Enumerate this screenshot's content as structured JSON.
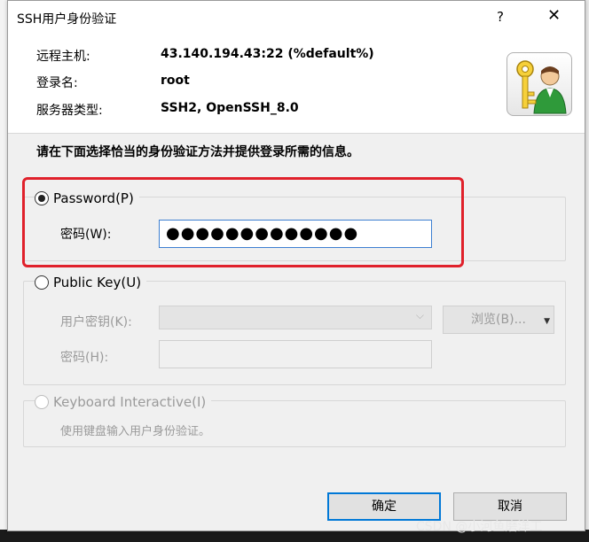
{
  "dialog": {
    "title": "SSH用户身份验证",
    "help": "?",
    "close": "✕"
  },
  "info": {
    "host_label": "远程主机:",
    "host_value": "43.140.194.43:22 (%default%)",
    "login_label": "登录名:",
    "login_value": "root",
    "server_type_label": "服务器类型:",
    "server_type_value": "SSH2, OpenSSH_8.0",
    "icon": "key-user-icon"
  },
  "instruction": "请在下面选择恰当的身份验证方法并提供登录所需的信息。",
  "password_section": {
    "radio_label": "Password",
    "radio_mnemonic": "(P)",
    "checked": true,
    "field_label": "密码(W):",
    "field_value": "●●●●●●●●●●●●●"
  },
  "public_key_section": {
    "radio_label": "Public Key",
    "radio_mnemonic": "(U)",
    "user_key_label": "用户密钥(K):",
    "browse_label": "浏览(B)...",
    "passphrase_label": "密码(H):"
  },
  "keyboard_section": {
    "radio_label": "Keyboard Interactive",
    "radio_mnemonic": "(I)",
    "hint": "使用键盘输入用户身份验证。"
  },
  "buttons": {
    "ok": "确定",
    "cancel": "取消"
  },
  "watermark": "CSDN @小河鱼磨洋工",
  "colors": {
    "highlight": "#e0212b",
    "focus": "#0078d7"
  }
}
